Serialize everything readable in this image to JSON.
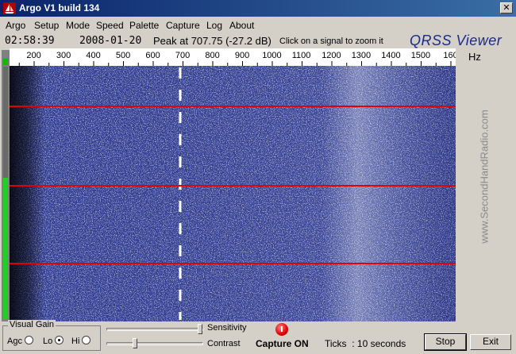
{
  "window": {
    "title": "Argo V1 build 134",
    "close_glyph": "✕"
  },
  "menu": [
    "Argo",
    "Setup",
    "Mode",
    "Speed",
    "Palette",
    "Capture",
    "Log",
    "About"
  ],
  "status": {
    "clock": "02:58:39",
    "date": "2008-01-20",
    "peak": "Peak at 707.75 (-27.2 dB)",
    "hint": "Click on a signal to zoom it",
    "brand": "QRSS Viewer"
  },
  "scale": {
    "ticks": [
      "200",
      "300",
      "400",
      "500",
      "600",
      "700",
      "800",
      "900",
      "1000",
      "1100",
      "1200",
      "1300",
      "1400",
      "1500",
      "160"
    ],
    "unit": "Hz"
  },
  "waterfall": {
    "background_color": "#2c3990",
    "noise_color": "#ffffff",
    "marker_color": "#e00000",
    "signal_trace_color": "#ffffff"
  },
  "watermark": "www.SecondHandRadio.com",
  "controls": {
    "visual_gain_label": "Visual Gain",
    "agc_label": "Agc",
    "lo_label": "Lo",
    "hi_label": "Hi",
    "selected_gain": "Lo",
    "sensitivity_label": "Sensitivity",
    "contrast_label": "Contrast",
    "capture_status": "Capture ON",
    "ticks_label": "Ticks",
    "ticks_value": ": 10 seconds",
    "stop_label": "Stop",
    "exit_label": "Exit"
  }
}
